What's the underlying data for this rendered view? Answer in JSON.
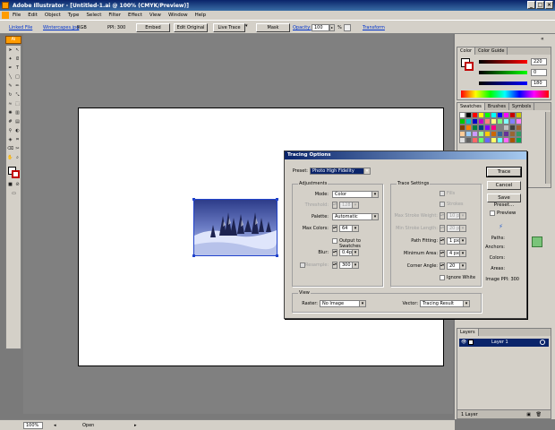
{
  "window": {
    "title": "Adobe Illustrator - [Untitled-1.ai @ 100% (CMYK/Preview)]"
  },
  "menu": [
    "File",
    "Edit",
    "Object",
    "Type",
    "Select",
    "Filter",
    "Effect",
    "View",
    "Window",
    "Help"
  ],
  "control": {
    "linked_file": "Linked File",
    "filename": "Wintercapes.jpg",
    "colormode": "RGB",
    "ppi": "PPI: 300",
    "embed": "Embed",
    "edit_original": "Edit Original",
    "live_trace": "Live Trace",
    "mask": "Mask",
    "opacity_label": "Opacity:",
    "opacity_value": "100",
    "percent": "%",
    "transform": "Transform"
  },
  "status": {
    "zoom": "100%",
    "info": "Open"
  },
  "color_panel": {
    "tabs": [
      "Color",
      "Color Guide"
    ],
    "values": [
      "220",
      "0",
      "180"
    ]
  },
  "swatches_panel": {
    "tabs": [
      "Swatches",
      "Brushes",
      "Symbols"
    ]
  },
  "layers_panel": {
    "tab": "Layers",
    "layer_name": "Layer 1",
    "count": "1 Layer"
  },
  "dialog": {
    "title": "Tracing Options",
    "preset_label": "Preset:",
    "preset_value": "Photo High Fidelity",
    "adjustments": {
      "label": "Adjustments",
      "mode_label": "Mode:",
      "mode_value": "Color",
      "threshold_label": "Threshold:",
      "threshold_value": "128",
      "palette_label": "Palette:",
      "palette_value": "Automatic",
      "maxcolors_label": "Max Colors:",
      "maxcolors_value": "64",
      "output_swatches": "Output to Swatches",
      "blur_label": "Blur:",
      "blur_value": "0.4px",
      "resample_label": "Resample:",
      "resample_value": "300 px"
    },
    "trace": {
      "label": "Trace Settings",
      "fills": "Fills",
      "strokes": "Strokes",
      "max_stroke_label": "Max Stroke Weight:",
      "max_stroke_value": "10 px",
      "min_stroke_label": "Min Stroke Length:",
      "min_stroke_value": "20 px",
      "path_fitting_label": "Path Fitting:",
      "path_fitting_value": "1 px",
      "min_area_label": "Minimum Area:",
      "min_area_value": "4 px",
      "corner_label": "Corner Angle:",
      "corner_value": "20",
      "ignore_white": "Ignore White"
    },
    "view": {
      "label": "View",
      "raster_label": "Raster:",
      "raster_value": "No Image",
      "vector_label": "Vector:",
      "vector_value": "Tracing Result"
    },
    "buttons": {
      "trace": "Trace",
      "cancel": "Cancel",
      "save_preset": "Save Preset...",
      "preview": "Preview"
    },
    "info": {
      "paths": "Paths:",
      "anchors": "Anchors:",
      "colors": "Colors:",
      "areas": "Areas:",
      "ppi": "Image PPI: 300"
    }
  }
}
